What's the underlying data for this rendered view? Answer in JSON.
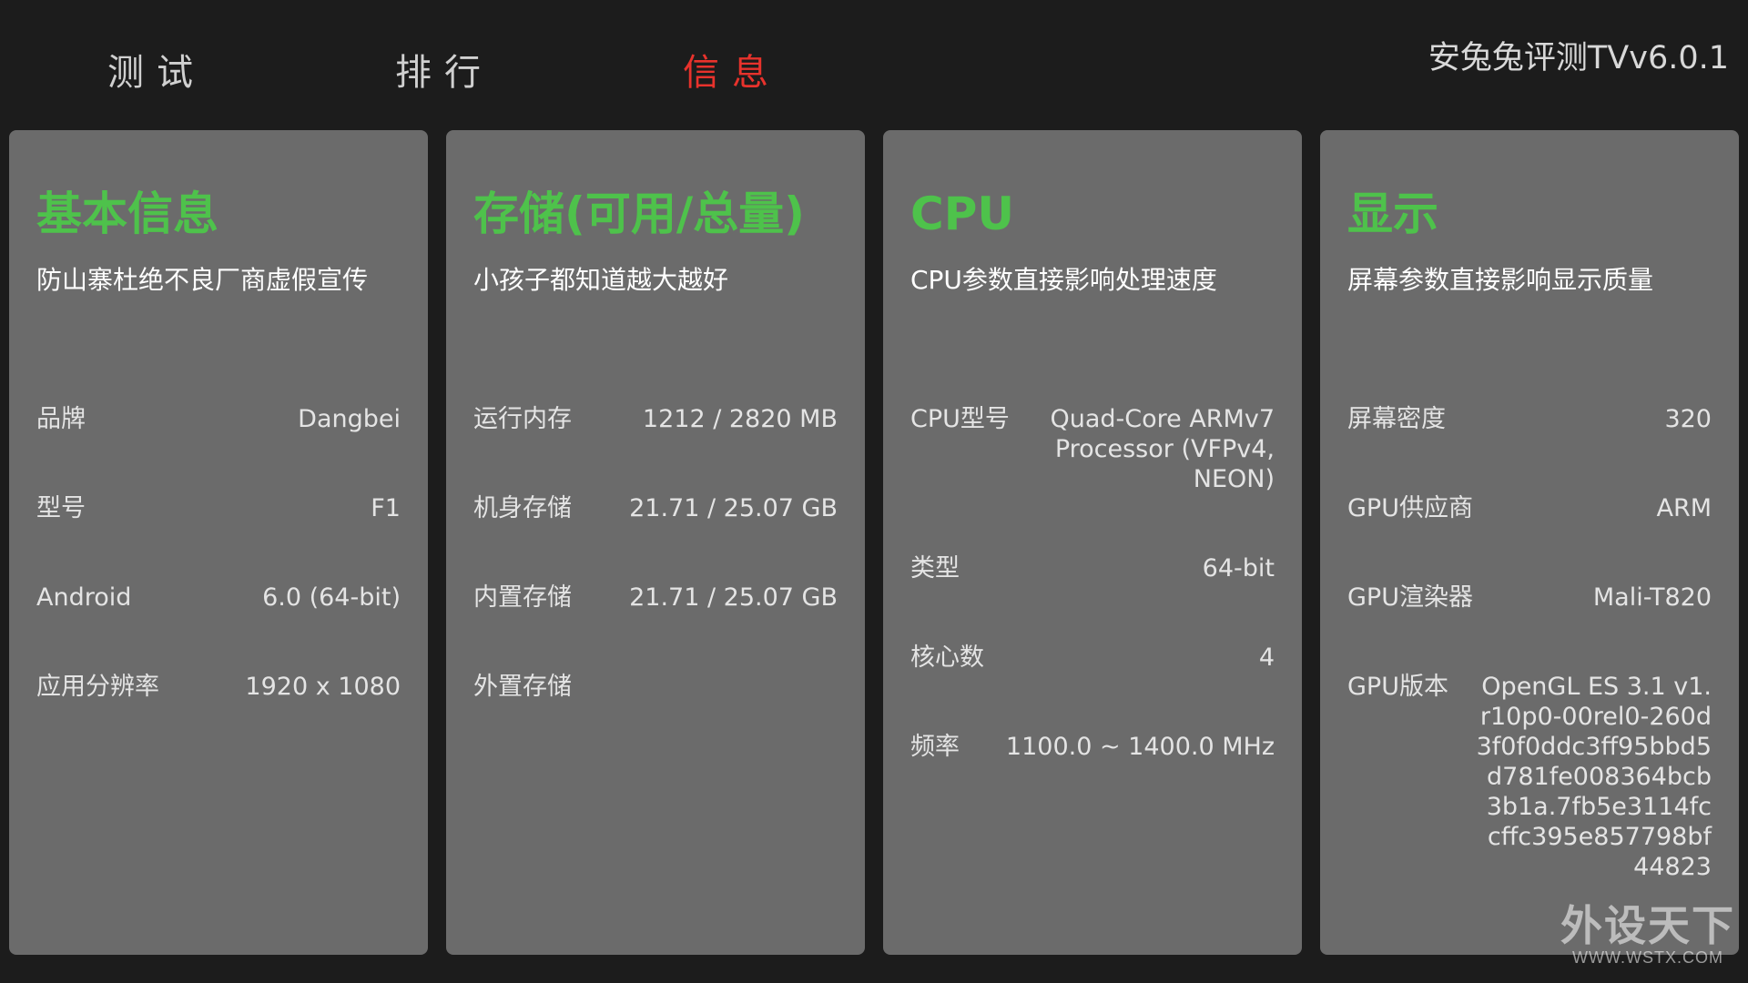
{
  "tabs": {
    "test": "测试",
    "rank": "排行",
    "info": "信息"
  },
  "active_tab": "info",
  "app_title": "安兔兔评测TVv6.0.1",
  "colors": {
    "background": "#1c1c1c",
    "card": "#6b6b6b",
    "accent_green": "#4ec24b",
    "active_tab_red": "#e8322c"
  },
  "cards": [
    {
      "title": "基本信息",
      "subtitle": "防山寨杜绝不良厂商虚假宣传",
      "rows": [
        {
          "label": "品牌",
          "value": "Dangbei"
        },
        {
          "label": "型号",
          "value": "F1"
        },
        {
          "label": "Android",
          "value": "6.0 (64-bit)"
        },
        {
          "label": "应用分辨率",
          "value": "1920 x 1080"
        }
      ]
    },
    {
      "title": "存储(可用/总量)",
      "subtitle": "小孩子都知道越大越好",
      "rows": [
        {
          "label": "运行内存",
          "value": "1212 / 2820 MB"
        },
        {
          "label": "机身存储",
          "value": "21.71 / 25.07 GB"
        },
        {
          "label": "内置存储",
          "value": "21.71 / 25.07 GB"
        },
        {
          "label": "外置存储",
          "value": ""
        }
      ]
    },
    {
      "title": "CPU",
      "subtitle": "CPU参数直接影响处理速度",
      "rows": [
        {
          "label": "CPU型号",
          "value": "Quad-Core ARMv7 Processor (VFPv4, NEON)"
        },
        {
          "label": "类型",
          "value": "64-bit"
        },
        {
          "label": "核心数",
          "value": "4"
        },
        {
          "label": "频率",
          "value": "1100.0 ~ 1400.0 MHz"
        }
      ]
    },
    {
      "title": "显示",
      "subtitle": "屏幕参数直接影响显示质量",
      "rows": [
        {
          "label": "屏幕密度",
          "value": "320"
        },
        {
          "label": "GPU供应商",
          "value": "ARM"
        },
        {
          "label": "GPU渲染器",
          "value": "Mali-T820"
        },
        {
          "label": "GPU版本",
          "value": "OpenGL ES 3.1 v1.r10p0-00rel0-260d3f0f0ddc3ff95bbd5d781fe008364bcb3b1a.7fb5e3114fccffc395e857798bf44823"
        }
      ]
    }
  ],
  "watermark": {
    "main": "外设天下",
    "sub": "WWW.WSTX.COM"
  }
}
